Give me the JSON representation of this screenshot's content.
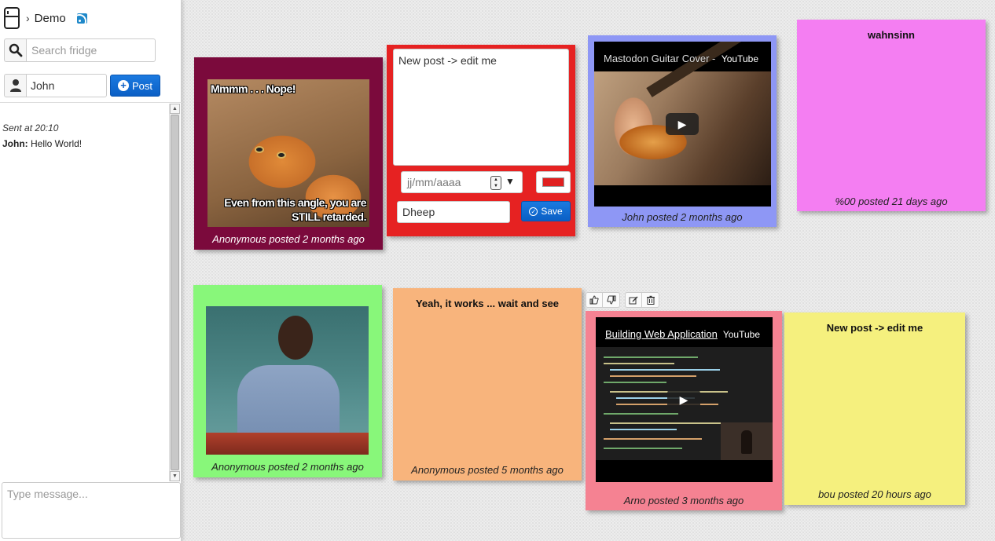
{
  "app": {
    "name": "Demo"
  },
  "sidebar": {
    "search_placeholder": "Search fridge",
    "username": "John",
    "post_label": "Post",
    "chat": [
      {
        "meta": "Sent at 20:10",
        "user": "John:",
        "text": " Hello World!"
      }
    ],
    "message_placeholder": "Type message..."
  },
  "notes": [
    {
      "id": "cat-meme",
      "color": "#7b0a3c",
      "type": "image",
      "meme_top": "Mmmm . . . Nope!",
      "meme_bottom": "Even from this angle, you are STILL retarded.",
      "footer": "Anonymous posted 2 months ago"
    },
    {
      "id": "editor",
      "color": "#e62222",
      "type": "editor",
      "text": "New post -> edit me",
      "date_placeholder": "jj/mm/aaaa",
      "swatch_color": "#e02020",
      "author": "Dheep",
      "save_label": "Save"
    },
    {
      "id": "guitar-video",
      "color": "#8e97f5",
      "type": "video",
      "video_title": "Mastodon Guitar Cover -",
      "provider": "YouTube",
      "footer": "John posted 2 months ago"
    },
    {
      "id": "wahnsinn",
      "color": "#f47ef2",
      "type": "text",
      "title": "wahnsinn",
      "footer": "%00 posted 21 days ago"
    },
    {
      "id": "man-photo",
      "color": "#88f77a",
      "type": "image",
      "footer": "Anonymous posted 2 months ago"
    },
    {
      "id": "works",
      "color": "#f8b47c",
      "type": "text",
      "title": "Yeah, it works ... wait and see",
      "footer": "Anonymous posted 5 months ago"
    },
    {
      "id": "webapp-video",
      "color": "#f58292",
      "type": "video",
      "video_title": "Building Web Application",
      "provider": "YouTube",
      "footer": "Arno posted 3 months ago"
    },
    {
      "id": "new-post",
      "color": "#f5f07e",
      "type": "text",
      "title": "New post -> edit me",
      "footer": "bou posted 20 hours ago"
    }
  ],
  "toolbar": {
    "icons": [
      "thumbs-up-icon",
      "thumbs-down-icon",
      "edit-icon",
      "trash-icon"
    ]
  }
}
